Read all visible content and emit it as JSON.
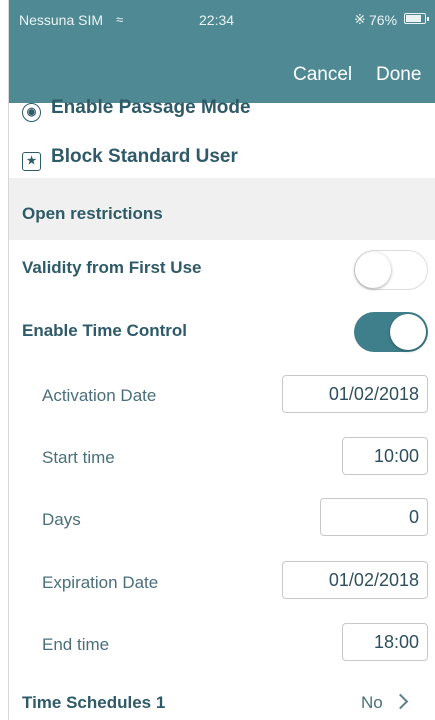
{
  "status_bar": {
    "carrier": "Nessuna SIM",
    "wifi_icon": "wifi-icon",
    "time": "22:34",
    "bluetooth_icon": "bluetooth-icon",
    "battery_percent": "76%",
    "battery_icon": "battery-icon"
  },
  "nav": {
    "cancel": "Cancel",
    "done": "Done"
  },
  "actions": [
    {
      "label": "Enable Passage Mode",
      "icon": "lock-icon"
    },
    {
      "label": "Block Standard User",
      "icon": "star-tag-icon"
    }
  ],
  "section_title": "Open restrictions",
  "validity": {
    "label": "Validity from First Use",
    "enabled": false
  },
  "time_control": {
    "label": "Enable Time Control",
    "enabled": true
  },
  "fields": {
    "activation_date": {
      "label": "Activation Date",
      "value": "01/02/2018"
    },
    "start_time": {
      "label": "Start time",
      "value": "10:00"
    },
    "days": {
      "label": "Days",
      "value": "0"
    },
    "expiration_date": {
      "label": "Expiration Date",
      "value": "01/02/2018"
    },
    "end_time": {
      "label": "End time",
      "value": "18:00"
    }
  },
  "schedules": {
    "label": "Time Schedules 1",
    "value": "No"
  },
  "colors": {
    "header": "#4f8a94",
    "accent": "#3f7f8c",
    "section_bg": "#f0f0f0"
  }
}
